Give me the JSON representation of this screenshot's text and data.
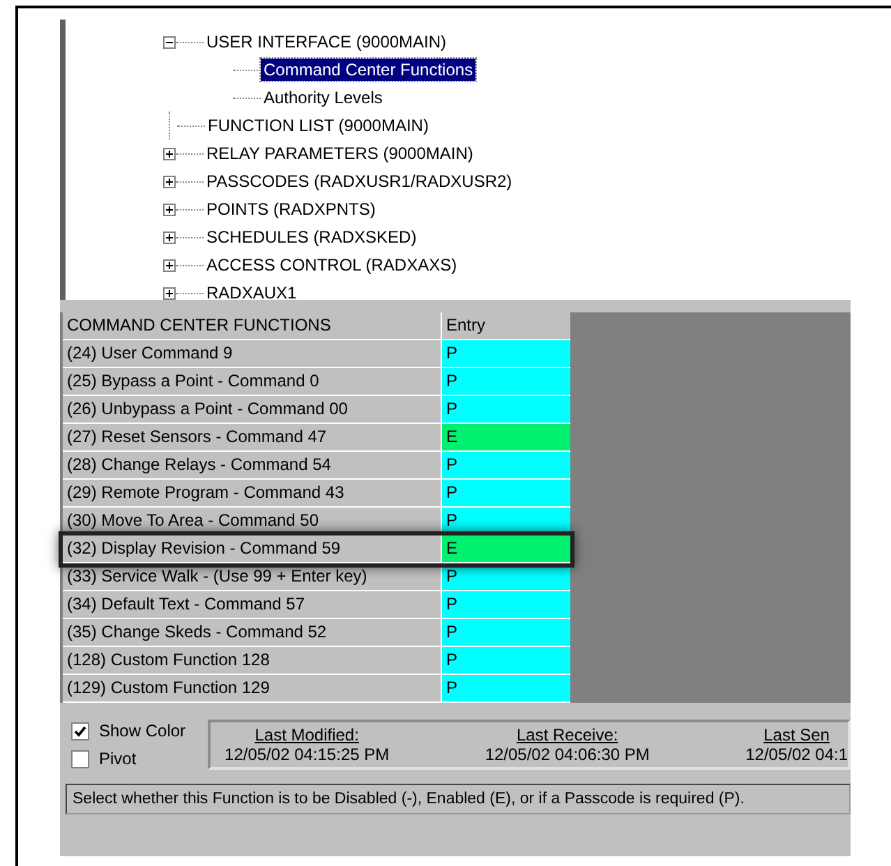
{
  "tree": [
    {
      "label": "USER INTERFACE (9000MAIN)",
      "expanded": true,
      "children": [
        {
          "label": "Command Center Functions",
          "selected": true
        },
        {
          "label": "Authority Levels",
          "selected": false
        }
      ]
    },
    {
      "label": "FUNCTION LIST (9000MAIN)",
      "kind": "leaf"
    },
    {
      "label": "RELAY PARAMETERS (9000MAIN)",
      "expanded": false
    },
    {
      "label": "PASSCODES (RADXUSR1/RADXUSR2)",
      "expanded": false
    },
    {
      "label": "POINTS (RADXPNTS)",
      "expanded": false
    },
    {
      "label": "SCHEDULES (RADXSKED)",
      "expanded": false
    },
    {
      "label": "ACCESS CONTROL (RADXAXS)",
      "expanded": false
    },
    {
      "label": "RADXAUX1",
      "expanded": false
    }
  ],
  "table": {
    "columns": [
      "COMMAND CENTER FUNCTIONS",
      "Entry"
    ],
    "rows": [
      {
        "name": "(24) User Command 9",
        "entry": "P",
        "color": "#00ffff",
        "highlighted": false
      },
      {
        "name": "(25) Bypass a Point - Command 0",
        "entry": "P",
        "color": "#00ffff",
        "highlighted": false
      },
      {
        "name": "(26) Unbypass a Point - Command 00",
        "entry": "P",
        "color": "#00ffff",
        "highlighted": false
      },
      {
        "name": "(27) Reset Sensors - Command 47",
        "entry": "E",
        "color": "#00f070",
        "highlighted": false
      },
      {
        "name": "(28) Change Relays - Command 54",
        "entry": "P",
        "color": "#00ffff",
        "highlighted": false
      },
      {
        "name": "(29) Remote Program - Command 43",
        "entry": "P",
        "color": "#00ffff",
        "highlighted": false
      },
      {
        "name": "(30) Move To Area - Command 50",
        "entry": "P",
        "color": "#00ffff",
        "highlighted": false
      },
      {
        "name": "(32) Display Revision - Command 59",
        "entry": "E",
        "color": "#00f070",
        "highlighted": true
      },
      {
        "name": "(33) Service Walk - (Use 99 + Enter key)",
        "entry": "P",
        "color": "#00ffff",
        "highlighted": false
      },
      {
        "name": "(34) Default Text - Command 57",
        "entry": "P",
        "color": "#00ffff",
        "highlighted": false
      },
      {
        "name": "(35) Change Skeds - Command 52",
        "entry": "P",
        "color": "#00ffff",
        "highlighted": false
      },
      {
        "name": "(128) Custom Function 128",
        "entry": "P",
        "color": "#00ffff",
        "highlighted": false
      },
      {
        "name": "(129) Custom Function 129",
        "entry": "P",
        "color": "#00ffff",
        "highlighted": false
      }
    ]
  },
  "options": [
    {
      "label": "Show Color",
      "checked": true
    },
    {
      "label": "Pivot",
      "checked": false
    }
  ],
  "timestamps": [
    {
      "label": "Last Modified:",
      "value": "12/05/02 04:15:25 PM"
    },
    {
      "label": "Last Receive:",
      "value": "12/05/02 04:06:30 PM"
    },
    {
      "label": "Last Sen",
      "value": "12/05/02 04:1"
    }
  ],
  "status_bar": "Select whether this Function is to be Disabled (-), Enabled (E), or if a Passcode is required (P)."
}
